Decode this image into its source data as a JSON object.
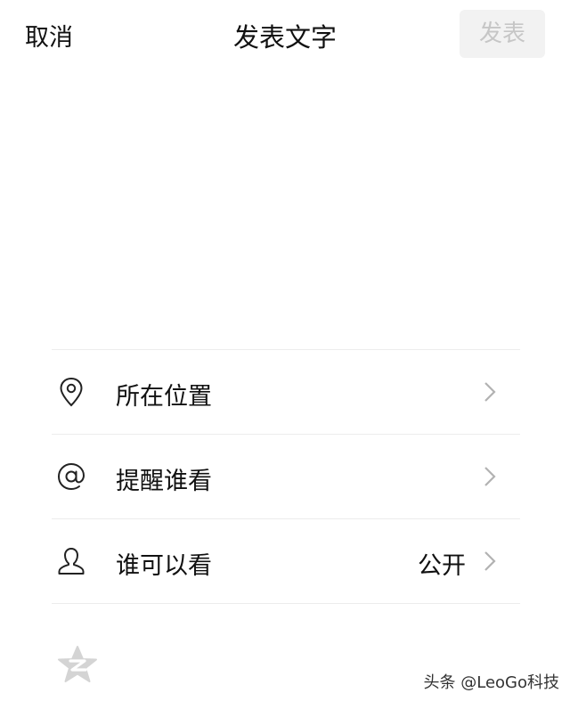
{
  "header": {
    "cancel_label": "取消",
    "title": "发表文字",
    "publish_label": "发表"
  },
  "options": [
    {
      "label": "所在位置",
      "icon": "location-pin-icon",
      "value": ""
    },
    {
      "label": "提醒谁看",
      "icon": "at-sign-icon",
      "value": ""
    },
    {
      "label": "谁可以看",
      "icon": "person-icon",
      "value": "公开"
    }
  ],
  "footer": {
    "share_icon": "qzone-star-icon",
    "watermark": "头条 @LeoGo科技"
  },
  "colors": {
    "publish_disabled_bg": "#f2f2f2",
    "publish_disabled_text": "#c6c6c6",
    "divider": "#ececec",
    "chevron": "#b2b2b2"
  }
}
